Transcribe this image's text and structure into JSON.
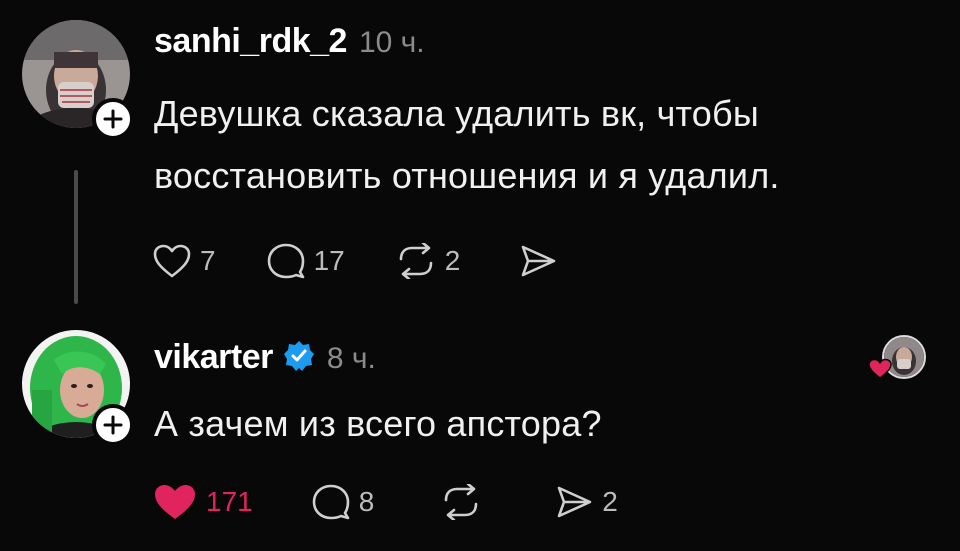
{
  "posts": [
    {
      "username": "sanhi_rdk_2",
      "time": "10 ч.",
      "text_lines": [
        "Девушка сказала удалить вк, чтобы",
        "восстановить отношения и я удалил."
      ],
      "likes": "7",
      "comments": "17",
      "reposts": "2",
      "shares": "",
      "liked": false,
      "verified": false,
      "avatar_icon": "avatar-masked-person"
    },
    {
      "username": "vikarter",
      "time": "8 ч.",
      "text_lines": [
        "А зачем из всего апстора?"
      ],
      "likes": "171",
      "comments": "8",
      "reposts": "",
      "shares": "2",
      "liked": true,
      "verified": true,
      "avatar_icon": "avatar-green-hair-person"
    }
  ],
  "colors": {
    "background": "#080808",
    "like_active": "#e0245e",
    "verified": "#1d9bf0",
    "muted": "#8b8b8b"
  }
}
